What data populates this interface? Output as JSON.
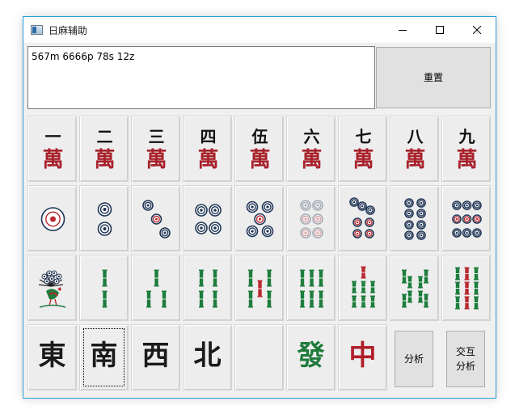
{
  "window": {
    "title": "日麻辅助"
  },
  "input": {
    "value": "567m 6666p 78s 12z"
  },
  "buttons": {
    "reset": "重置",
    "analyze": "分析",
    "interactive_line1": "交互",
    "interactive_line2": "分析"
  },
  "man": [
    {
      "numeral": "一",
      "char": "萬"
    },
    {
      "numeral": "二",
      "char": "萬"
    },
    {
      "numeral": "三",
      "char": "萬"
    },
    {
      "numeral": "四",
      "char": "萬"
    },
    {
      "numeral": "伍",
      "char": "萬"
    },
    {
      "numeral": "六",
      "char": "萬"
    },
    {
      "numeral": "七",
      "char": "萬"
    },
    {
      "numeral": "八",
      "char": "萬"
    },
    {
      "numeral": "九",
      "char": "萬"
    }
  ],
  "honors": [
    {
      "char": "東",
      "color": "#1a1a1a"
    },
    {
      "char": "南",
      "color": "#1a1a1a"
    },
    {
      "char": "西",
      "color": "#1a1a1a"
    },
    {
      "char": "北",
      "color": "#1a1a1a"
    },
    {
      "char": "",
      "color": "#1a1a1a"
    },
    {
      "char": "發",
      "color": "#1e7a3a"
    },
    {
      "char": "中",
      "color": "#b01e2a"
    }
  ],
  "colors": {
    "red": "#a8212b",
    "navy": "#1f3554",
    "green": "#1d7d3c",
    "pin_red": "#b8282f"
  }
}
